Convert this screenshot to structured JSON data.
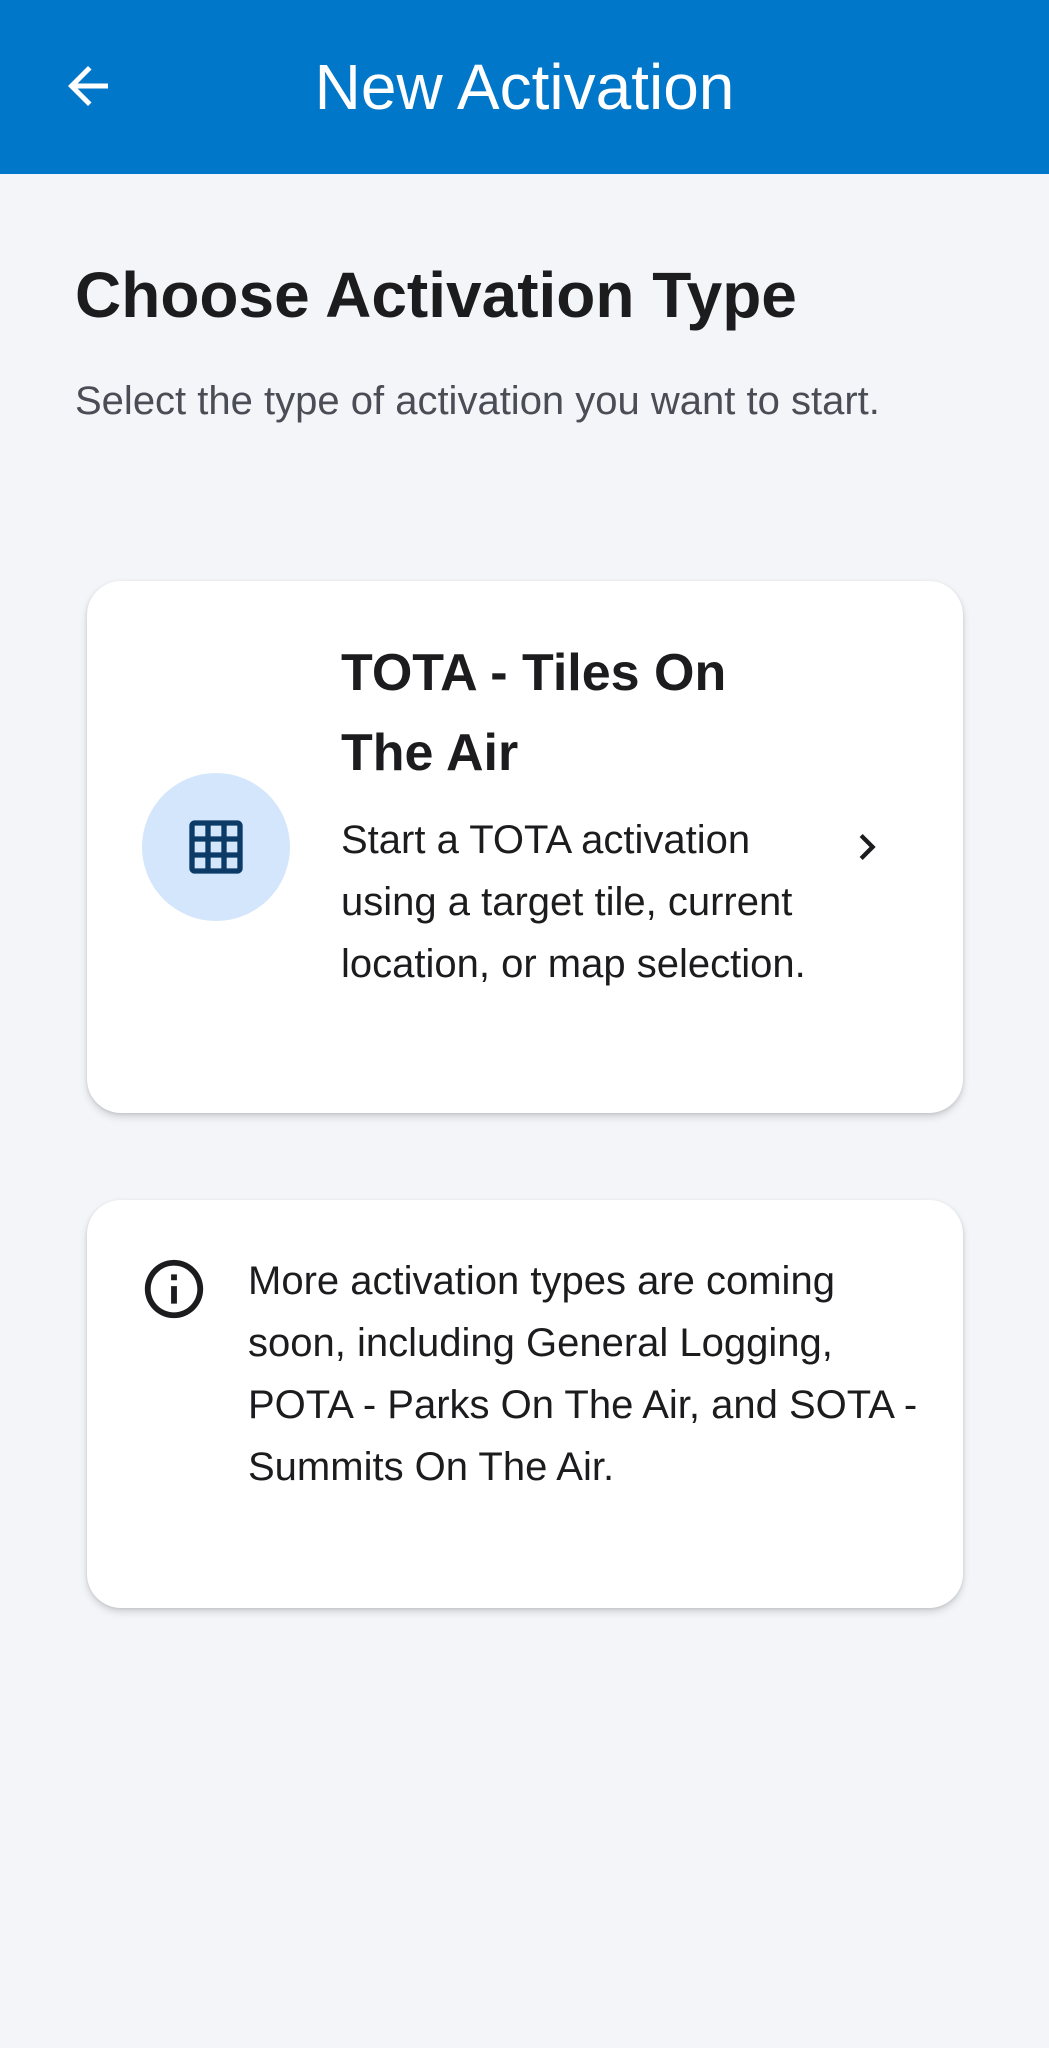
{
  "app_bar": {
    "title": "New Activation",
    "back_icon": "arrow-left-icon",
    "background": "#0077c8"
  },
  "main": {
    "heading": "Choose Activation Type",
    "subheading": "Select the type of activation you want to start."
  },
  "activation_types": [
    {
      "title": "TOTA - Tiles On The Air",
      "description": "Start a TOTA activation using a target tile, current location, or map selection.",
      "icon": "grid-icon",
      "icon_background": "#d4e6fb",
      "icon_color": "#0b3b66"
    }
  ],
  "info_card": {
    "icon": "info-icon",
    "text": "More activation types are coming soon, including General Logging, POTA - Parks On The Air, and SOTA - Summits On The Air."
  }
}
